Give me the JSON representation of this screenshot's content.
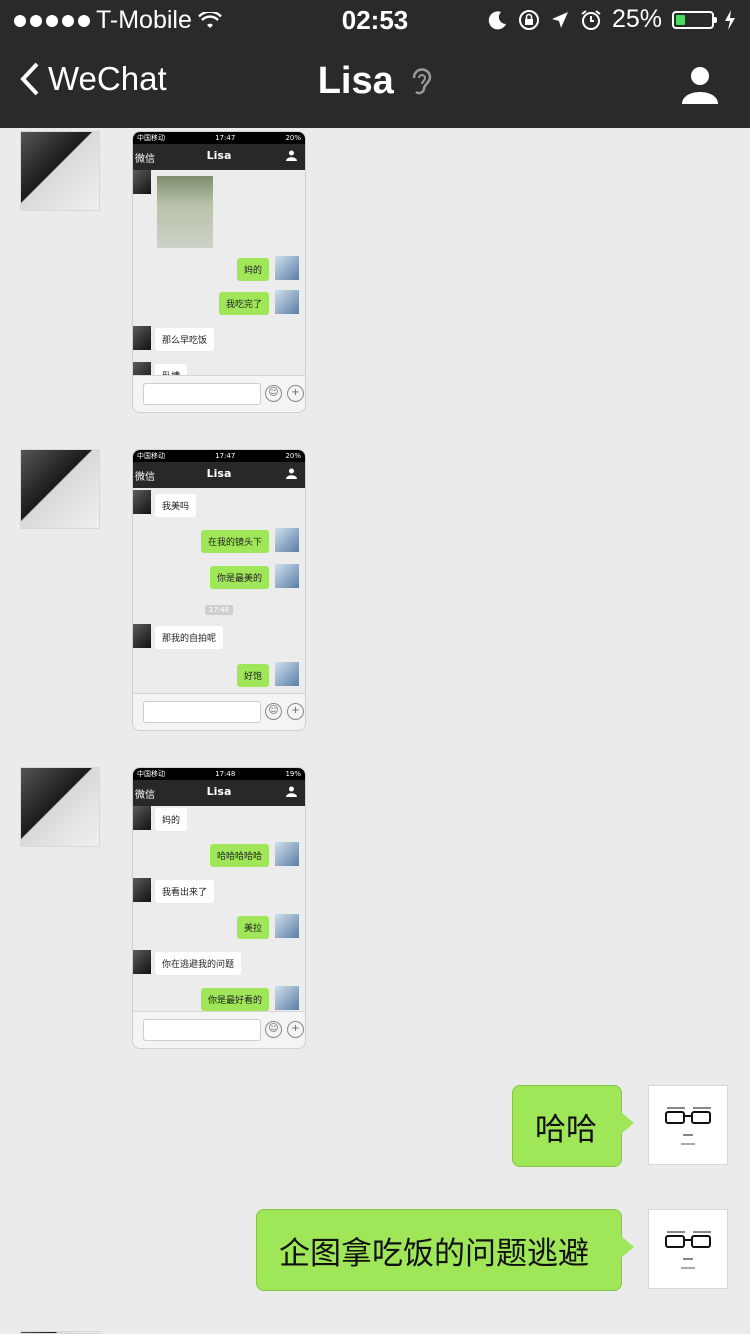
{
  "status_bar": {
    "carrier": "T-Mobile",
    "time": "02:53",
    "battery": "25%",
    "battery_level": 0.25
  },
  "nav": {
    "back_label": "WeChat",
    "title": "Lisa"
  },
  "thumbs": [
    {
      "status": {
        "carrier": "中国移动",
        "time": "17:47",
        "battery": "20%"
      },
      "nav": {
        "back": "微信",
        "title": "Lisa"
      },
      "messages": [
        "妈的",
        "我吃完了",
        "那么早吃饭",
        "卧槽"
      ]
    },
    {
      "status": {
        "carrier": "中国移动",
        "time": "17:47",
        "battery": "20%"
      },
      "nav": {
        "back": "微信",
        "title": "Lisa"
      },
      "messages": [
        "我美吗",
        "在我的镜头下",
        "你是最美的",
        "那我的自拍呢",
        "好饱"
      ],
      "timestamp": "17:48"
    },
    {
      "status": {
        "carrier": "中国移动",
        "time": "17:48",
        "battery": "19%"
      },
      "nav": {
        "back": "微信",
        "title": "Lisa"
      },
      "messages": [
        "妈的",
        "哈哈哈哈哈",
        "我看出来了",
        "美拉",
        "你在逃避我的问题",
        "你是最好看的"
      ]
    }
  ],
  "outgoing": [
    {
      "text": "哈哈"
    },
    {
      "text": "企图拿吃饭的问题逃避"
    }
  ]
}
